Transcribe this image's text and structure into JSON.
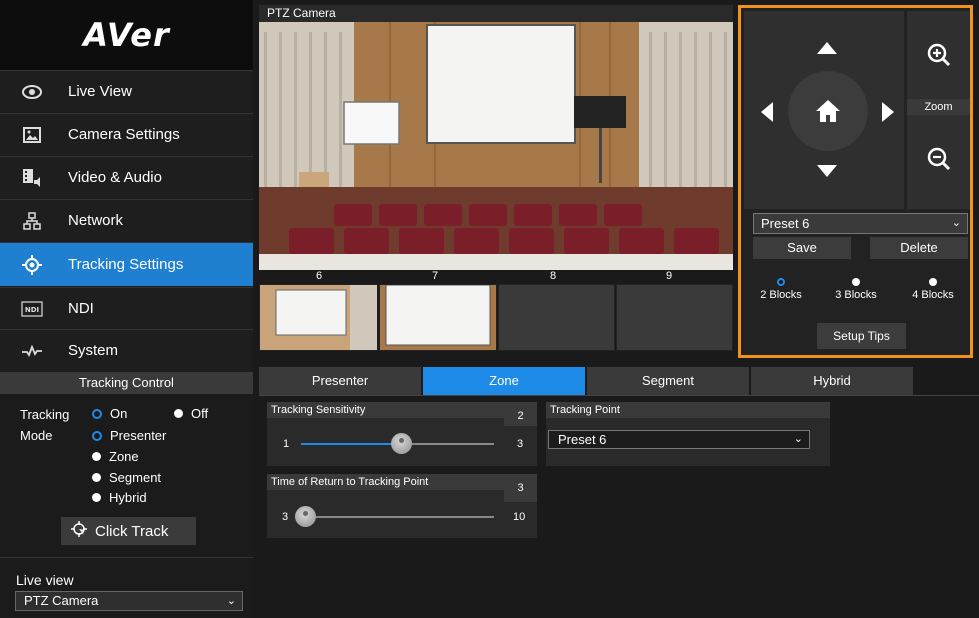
{
  "brand": "AVer",
  "nav": [
    {
      "label": "Live View",
      "icon": "eye-icon"
    },
    {
      "label": "Camera Settings",
      "icon": "image-icon"
    },
    {
      "label": "Video & Audio",
      "icon": "film-audio-icon"
    },
    {
      "label": "Network",
      "icon": "network-icon"
    },
    {
      "label": "Tracking Settings",
      "icon": "target-icon"
    },
    {
      "label": "NDI",
      "icon": "ndi-icon"
    },
    {
      "label": "System",
      "icon": "pulse-icon"
    }
  ],
  "tracking_control": {
    "title": "Tracking Control",
    "tracking_label": "Tracking",
    "mode_label": "Mode",
    "on": "On",
    "off": "Off",
    "modes": [
      "Presenter",
      "Zone",
      "Segment",
      "Hybrid"
    ],
    "selected_mode": "Presenter",
    "tracking_on": true,
    "click_track": "Click Track"
  },
  "live_view": {
    "label": "Live view",
    "selected": "PTZ Camera"
  },
  "video": {
    "title": "PTZ Camera",
    "preset_numbers": [
      "6",
      "7",
      "8",
      "9"
    ]
  },
  "ptz": {
    "zoom_label": "Zoom",
    "preset_selected": "Preset 6",
    "save": "Save",
    "delete": "Delete",
    "blocks": [
      "2 Blocks",
      "3 Blocks",
      "4 Blocks"
    ],
    "selected_blocks": "2 Blocks",
    "setup_tips": "Setup Tips",
    "highlight_color": "#f0921e"
  },
  "tabs": [
    "Presenter",
    "Zone",
    "Segment",
    "Hybrid"
  ],
  "active_tab": "Zone",
  "zone": {
    "sensitivity": {
      "title": "Tracking Sensitivity",
      "value": "2",
      "min": "1",
      "max": "3"
    },
    "return_time": {
      "title": "Time of Return to Tracking Point",
      "value": "3",
      "min": "3",
      "max": "10"
    },
    "tracking_point": {
      "title": "Tracking Point",
      "selected": "Preset 6"
    }
  },
  "colors": {
    "accent": "#1f8be8",
    "active_nav": "#1f7fd0"
  }
}
